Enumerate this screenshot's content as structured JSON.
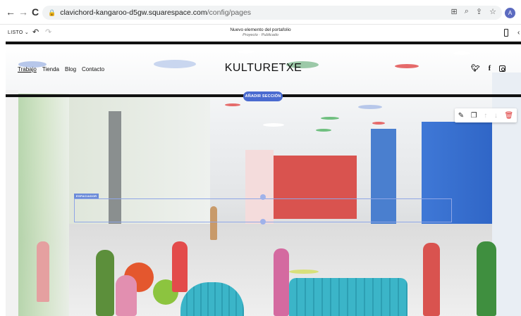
{
  "browser": {
    "url_domain": "clavichord-kangaroo-d5gw.squarespace.com",
    "url_path": "/config/pages",
    "avatar_initial": "A"
  },
  "editor": {
    "done_label": "LISTO",
    "page_title": "Nuevo elemento del portafolio",
    "page_status": "Proyecto · Publicado"
  },
  "site": {
    "logo": "KULTURETXE",
    "nav": [
      "Trabajo",
      "Tienda",
      "Blog",
      "Contacto"
    ],
    "add_section_label": "AÑADIR SECCIÓN",
    "spacer_label": "ESPACIADOR"
  },
  "colors": {
    "accent": "#4a6bd0",
    "spacer": "#6b8bd9",
    "delete": "#dd3333"
  },
  "icons": {
    "back": "arrow-left",
    "forward": "arrow-right",
    "reload": "refresh",
    "lock": "lock",
    "undo": "undo",
    "redo": "redo",
    "mobile": "mobile-phone",
    "social": [
      "twitter",
      "facebook",
      "instagram"
    ],
    "block_tools": [
      "pencil",
      "duplicate",
      "arrow-up",
      "arrow-down",
      "trash"
    ]
  }
}
